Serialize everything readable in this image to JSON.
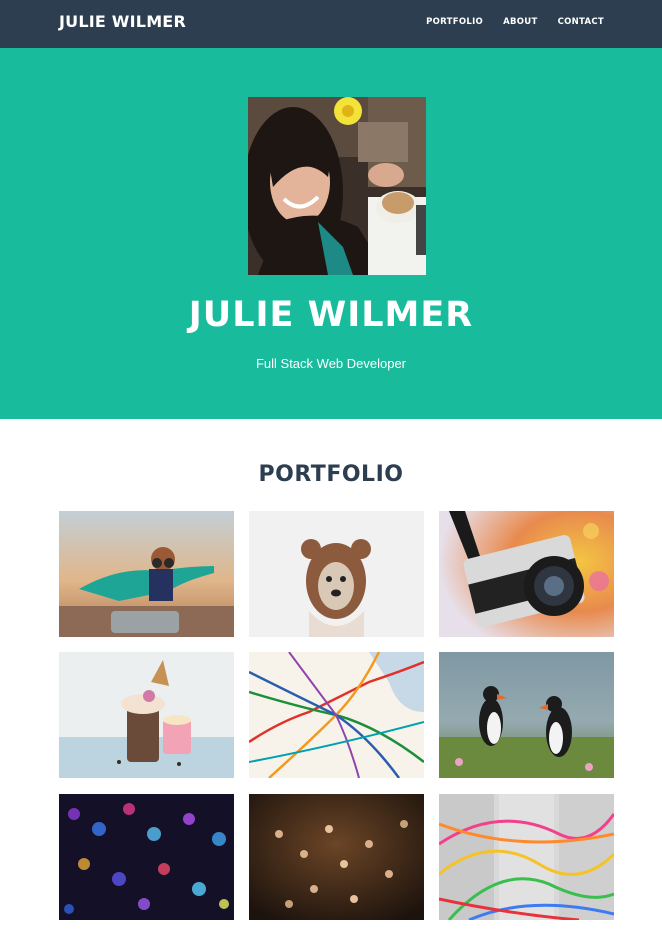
{
  "nav": {
    "brand": "JULIE WILMER",
    "links": [
      "PORTFOLIO",
      "ABOUT",
      "CONTACT"
    ]
  },
  "hero": {
    "name": "JULIE WILMER",
    "tagline": "Full Stack Web Developer"
  },
  "portfolio": {
    "title": "PORTFOLIO",
    "items": [
      "boy-pilot-in-suitcase",
      "dog-in-bear-hat",
      "vintage-camera",
      "ice-cream-milkshake",
      "subway-map",
      "puffins",
      "colorful-bokeh-lights",
      "crowd-from-above",
      "modular-synth-cables"
    ]
  },
  "colors": {
    "navbar": "#2c3e50",
    "hero": "#18bc9c",
    "heading": "#2c3e50"
  }
}
